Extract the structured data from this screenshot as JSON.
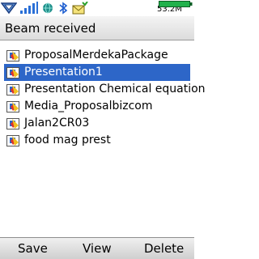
{
  "status_bar": {
    "memory": "53.2M",
    "icons": [
      "network-menu-icon",
      "signal-strength-icon",
      "browser-globe-icon",
      "bluetooth-icon",
      "new-message-icon",
      "battery-icon"
    ]
  },
  "title": "Beam received",
  "items": [
    {
      "label": "ProposalMerdekaPackage",
      "icon": "presentation-file-icon",
      "selected": false
    },
    {
      "label": "Presentation1",
      "icon": "presentation-file-icon",
      "selected": true
    },
    {
      "label": "Presentation Chemical equation",
      "icon": "presentation-file-icon",
      "selected": false
    },
    {
      "label": "Media_Proposalbizcom",
      "icon": "presentation-file-icon",
      "selected": false
    },
    {
      "label": "Jalan2CR03",
      "icon": "presentation-file-icon",
      "selected": false
    },
    {
      "label": "food mag prest",
      "icon": "presentation-file-icon",
      "selected": false
    }
  ],
  "softkeys": {
    "left": "Save",
    "center": "View",
    "right": "Delete"
  },
  "colors": {
    "selection": "#2d66c8",
    "signal": "#2a6fd6",
    "battery": "#22b14c"
  }
}
